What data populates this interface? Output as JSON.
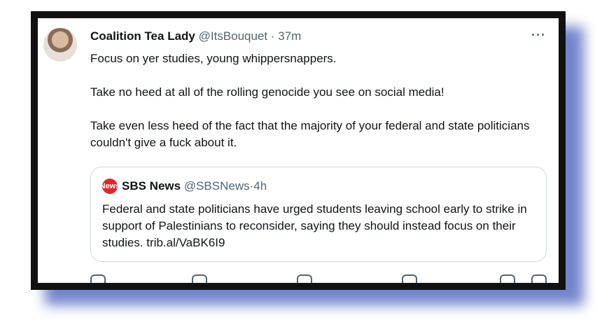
{
  "post": {
    "author_name": "Coalition Tea Lady",
    "handle": "@ItsBouquet",
    "dot": " · ",
    "time": "37m",
    "more": "···",
    "paragraphs": [
      "Focus on yer studies, young whippersnappers.",
      "Take no heed at all of the rolling genocide you see on social media!",
      "Take even less heed of the fact that the majority of your federal and state politicians couldn't give a fuck about it."
    ]
  },
  "quoted": {
    "logo_text": "News",
    "author_name": "SBS News",
    "handle": "@SBSNews",
    "dot": " · ",
    "time": "4h",
    "text": "Federal and state politicians have urged students leaving school early to strike in support of Palestinians to reconsider, saying they should instead focus on their studies. trib.al/VaBK6I9"
  },
  "icons": [
    "reply-icon",
    "retweet-icon",
    "like-icon",
    "views-icon",
    "bookmark-icon",
    "share-icon"
  ]
}
